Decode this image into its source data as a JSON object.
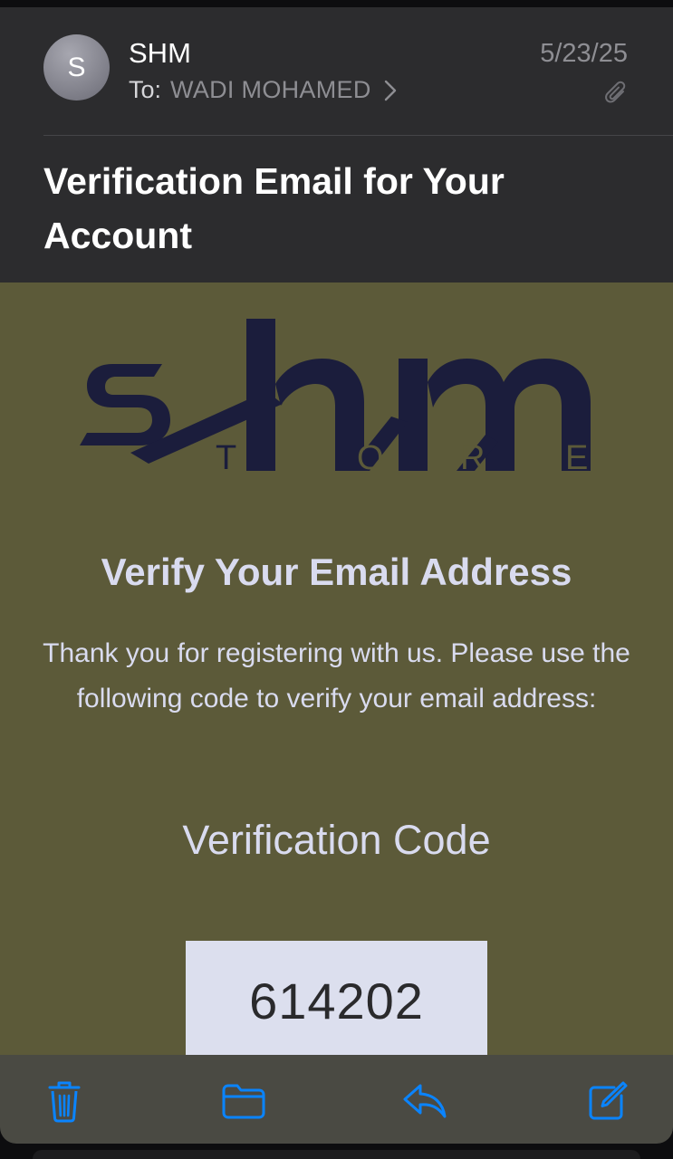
{
  "header": {
    "avatar_initial": "S",
    "sender": "SHM",
    "to_label": "To:",
    "recipient": "WADI MOHAMED",
    "date": "5/23/25",
    "subject": "Verification Email for Your Account"
  },
  "email": {
    "logo_wordmark": "shm",
    "logo_subtitle": "TORE",
    "heading": "Verify Your Email Address",
    "message": "Thank you for registering with us. Please use the following code to verify your email address:",
    "code_label": "Verification Code",
    "code": "614202"
  },
  "toolbar": {
    "icons": [
      "trash-icon",
      "folder-icon",
      "reply-icon",
      "compose-icon"
    ]
  },
  "colors": {
    "header_bg": "#2c2c2e",
    "email_bg": "#5c5a39",
    "logo_navy": "#1b1d3c",
    "text_light": "#d9dbef",
    "code_box_bg": "#dcdfee",
    "toolbar_bg": "#4a4a43",
    "accent_blue": "#0a84ff"
  }
}
